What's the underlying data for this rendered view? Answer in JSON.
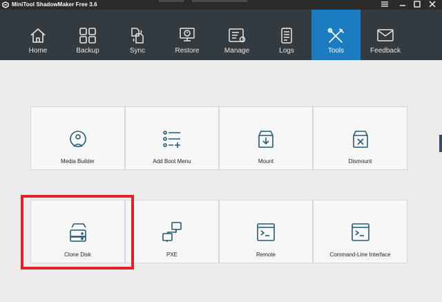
{
  "window": {
    "title": "MiniTool ShadowMaker Free 3.6",
    "controls": [
      "menu-icon",
      "minimize-icon",
      "maximize-icon",
      "close-icon"
    ]
  },
  "nav": {
    "active": "Tools",
    "items": [
      {
        "label": "Home",
        "icon": "home-icon"
      },
      {
        "label": "Backup",
        "icon": "backup-icon"
      },
      {
        "label": "Sync",
        "icon": "sync-icon"
      },
      {
        "label": "Restore",
        "icon": "restore-icon"
      },
      {
        "label": "Manage",
        "icon": "manage-icon"
      },
      {
        "label": "Logs",
        "icon": "logs-icon"
      },
      {
        "label": "Tools",
        "icon": "tools-icon"
      },
      {
        "label": "Feedback",
        "icon": "feedback-icon"
      }
    ]
  },
  "tools": {
    "row1": [
      {
        "label": "Media Builder",
        "icon": "media-builder-icon"
      },
      {
        "label": "Add Boot Menu",
        "icon": "add-boot-menu-icon"
      },
      {
        "label": "Mount",
        "icon": "mount-icon"
      },
      {
        "label": "Dismount",
        "icon": "dismount-icon"
      }
    ],
    "row2": [
      {
        "label": "Clone Disk",
        "icon": "clone-disk-icon"
      },
      {
        "label": "PXE",
        "icon": "pxe-icon"
      },
      {
        "label": "Remote",
        "icon": "remote-icon"
      },
      {
        "label": "Command-Line Interface",
        "icon": "command-line-icon"
      }
    ]
  },
  "colors": {
    "title_bar": "#2b2b2b",
    "nav_background": "#333a40",
    "nav_active": "#1b7cc1",
    "content_background": "#ececec",
    "tile_background": "#f7f7f7",
    "tile_icon": "#1f5a7a",
    "highlight": "#e0232d"
  }
}
